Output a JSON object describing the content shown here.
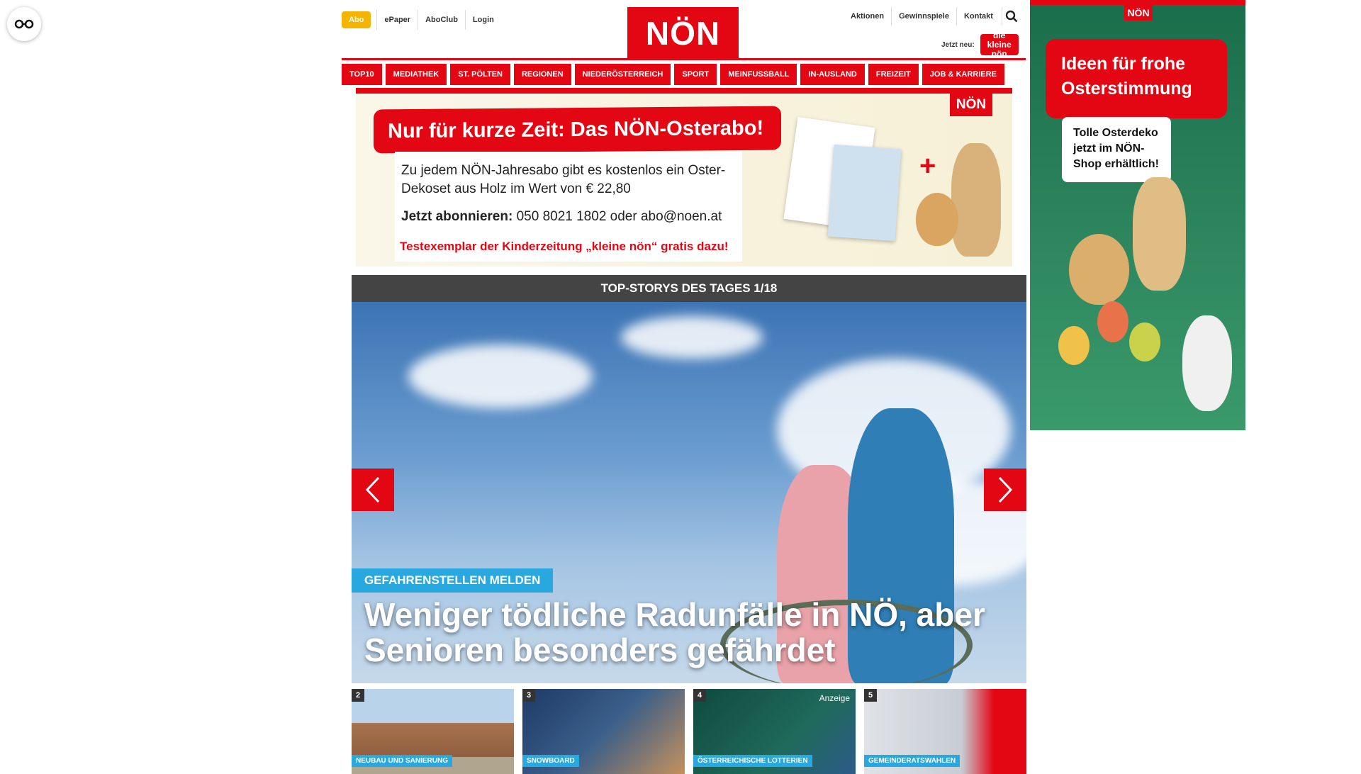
{
  "accessibility": {
    "icon": "glasses-icon"
  },
  "topbar": {
    "abo": "Abo",
    "links": [
      "ePaper",
      "AboClub",
      "Login"
    ]
  },
  "logo": "NÖN",
  "rightlinks": [
    "Aktionen",
    "Gewinnspiele",
    "Kontakt"
  ],
  "search_icon": "search-icon",
  "jetzt_neu": {
    "label": "Jetzt neu:",
    "badge": "die kleine nön"
  },
  "nav": [
    "TOP10",
    "MEDIATHEK",
    "ST. PÖLTEN",
    "REGIONEN",
    "NIEDERÖSTERREICH",
    "SPORT",
    "MEINFUSSBALL",
    "IN-AUSLAND",
    "FREIZEIT",
    "JOB & KARRIERE"
  ],
  "banner": {
    "headline": "Nur für kurze Zeit: Das NÖN-Osterabo!",
    "text1": "Zu jedem NÖN-Jahresabo gibt es kostenlos ein Oster-Dekoset aus Holz im Wert von € 22,80",
    "text2_bold": "Jetzt abonnieren:",
    "text2_rest": " 050 8021 1802 oder abo@noen.at",
    "text3": "Testexemplar der Kinderzeitung „kleine nön“ gratis dazu!",
    "brand": "NÖN"
  },
  "sidead": {
    "brand": "NÖN",
    "headline": "Ideen für frohe Osterstimmung",
    "card": "Tolle Osterdeko jetzt im NÖN-Shop erhältlich!"
  },
  "slider": {
    "header": "TOP-STORYS DES TAGES 1/18",
    "tag": "GEFAHRENSTELLEN MELDEN",
    "title": "Weniger tödliche Radunfälle in NÖ, aber Senioren besonders gefährdet"
  },
  "thumbs": [
    {
      "num": "2",
      "category": "Neubau und Sanierung",
      "color": "#a8724e"
    },
    {
      "num": "3",
      "category": "Snowboard",
      "color": "#3b5f8a"
    },
    {
      "num": "4",
      "category": "Österreichische Lotterien",
      "color": "#1f6a5a",
      "ad": "Anzeige"
    },
    {
      "num": "5",
      "category": "Gemeinderatswahlen",
      "color": "#c8cdd3"
    }
  ]
}
